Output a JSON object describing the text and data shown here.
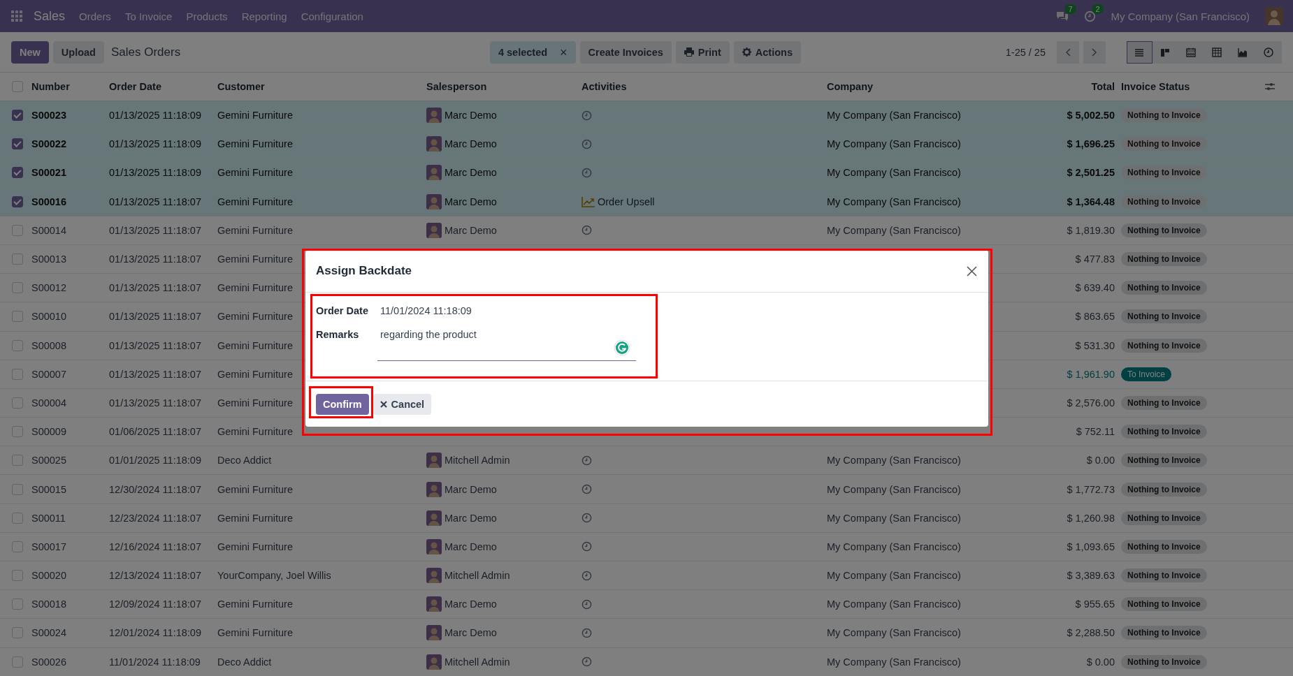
{
  "navbar": {
    "app": "Sales",
    "menus": [
      "Orders",
      "To Invoice",
      "Products",
      "Reporting",
      "Configuration"
    ],
    "messages_badge": "7",
    "activities_badge": "2",
    "company": "My Company (San Francisco)"
  },
  "control_panel": {
    "buttons": [
      {
        "label": "New",
        "kind": "primary"
      },
      {
        "label": "Upload",
        "kind": "secondary"
      }
    ],
    "title": "Sales Orders",
    "selection": {
      "label": "4 selected",
      "clear": "×"
    },
    "actions": [
      {
        "label": "Create Invoices"
      },
      {
        "label": "Print"
      },
      {
        "label": "Actions"
      }
    ],
    "pager": "1-25 / 25",
    "views": [
      {
        "kind": "list",
        "selected": true
      },
      {
        "kind": "kanban",
        "selected": false
      },
      {
        "kind": "calendar",
        "selected": false
      },
      {
        "kind": "pivot",
        "selected": false
      },
      {
        "kind": "graph",
        "selected": false
      },
      {
        "kind": "activity",
        "selected": false
      }
    ]
  },
  "table": {
    "select_all": {
      "checked": false
    },
    "columns": [
      "Number",
      "Order Date",
      "Customer",
      "Salesperson",
      "Activities",
      "Company",
      "Total",
      "Invoice Status"
    ],
    "rows": [
      {
        "number": "S00023",
        "order_date": "01/13/2025 11:18:09",
        "customer": "Gemini Furniture",
        "salesperson": "Marc Demo",
        "activity": {
          "kind": "clock"
        },
        "company": "My Company (San Francisco)",
        "total": "$ 5,002.50",
        "status": {
          "label": "Nothing to Invoice",
          "kind": "nothing"
        },
        "selected": true
      },
      {
        "number": "S00022",
        "order_date": "01/13/2025 11:18:09",
        "customer": "Gemini Furniture",
        "salesperson": "Marc Demo",
        "activity": {
          "kind": "clock"
        },
        "company": "My Company (San Francisco)",
        "total": "$ 1,696.25",
        "status": {
          "label": "Nothing to Invoice",
          "kind": "nothing"
        },
        "selected": true
      },
      {
        "number": "S00021",
        "order_date": "01/13/2025 11:18:09",
        "customer": "Gemini Furniture",
        "salesperson": "Marc Demo",
        "activity": {
          "kind": "clock"
        },
        "company": "My Company (San Francisco)",
        "total": "$ 2,501.25",
        "status": {
          "label": "Nothing to Invoice",
          "kind": "nothing"
        },
        "selected": true
      },
      {
        "number": "S00016",
        "order_date": "01/13/2025 11:18:07",
        "customer": "Gemini Furniture",
        "salesperson": "Marc Demo",
        "activity": {
          "kind": "upsell",
          "label": "Order Upsell"
        },
        "company": "My Company (San Francisco)",
        "total": "$ 1,364.48",
        "status": {
          "label": "Nothing to Invoice",
          "kind": "nothing"
        },
        "selected": true
      },
      {
        "number": "S00014",
        "order_date": "01/13/2025 11:18:07",
        "customer": "Gemini Furniture",
        "salesperson": "Marc Demo",
        "activity": {
          "kind": "clock"
        },
        "company": "My Company (San Francisco)",
        "total": "$ 1,819.30",
        "status": {
          "label": "Nothing to Invoice",
          "kind": "nothing"
        },
        "selected": false
      },
      {
        "number": "S00013",
        "order_date": "01/13/2025 11:18:07",
        "customer": "Gemini Furniture",
        "total": "$ 477.83",
        "status": {
          "label": "Nothing to Invoice",
          "kind": "nothing"
        },
        "selected": false
      },
      {
        "number": "S00012",
        "order_date": "01/13/2025 11:18:07",
        "customer": "Gemini Furniture",
        "total": "$ 639.40",
        "status": {
          "label": "Nothing to Invoice",
          "kind": "nothing"
        },
        "selected": false
      },
      {
        "number": "S00010",
        "order_date": "01/13/2025 11:18:07",
        "customer": "Gemini Furniture",
        "total": "$ 863.65",
        "status": {
          "label": "Nothing to Invoice",
          "kind": "nothing"
        },
        "selected": false
      },
      {
        "number": "S00008",
        "order_date": "01/13/2025 11:18:07",
        "customer": "Gemini Furniture",
        "total": "$ 531.30",
        "status": {
          "label": "Nothing to Invoice",
          "kind": "nothing"
        },
        "selected": false
      },
      {
        "number": "S00007",
        "order_date": "01/13/2025 11:18:07",
        "customer": "Gemini Furniture",
        "total": "$ 1,961.90",
        "status": {
          "label": "To Invoice",
          "kind": "to_invoice"
        },
        "selected": false
      },
      {
        "number": "S00004",
        "order_date": "01/13/2025 11:18:07",
        "customer": "Gemini Furniture",
        "total": "$ 2,576.00",
        "status": {
          "label": "Nothing to Invoice",
          "kind": "nothing"
        },
        "selected": false
      },
      {
        "number": "S00009",
        "order_date": "01/06/2025 11:18:07",
        "customer": "Gemini Furniture",
        "total": "$ 752.11",
        "status": {
          "label": "Nothing to Invoice",
          "kind": "nothing"
        },
        "selected": false
      },
      {
        "number": "S00025",
        "order_date": "01/01/2025 11:18:09",
        "customer": "Deco Addict",
        "salesperson": "Mitchell Admin",
        "activity": {
          "kind": "clock"
        },
        "company": "My Company (San Francisco)",
        "total": "$ 0.00",
        "status": {
          "label": "Nothing to Invoice",
          "kind": "nothing"
        },
        "selected": false
      },
      {
        "number": "S00015",
        "order_date": "12/30/2024 11:18:07",
        "customer": "Gemini Furniture",
        "salesperson": "Marc Demo",
        "activity": {
          "kind": "clock"
        },
        "company": "My Company (San Francisco)",
        "total": "$ 1,772.73",
        "status": {
          "label": "Nothing to Invoice",
          "kind": "nothing"
        },
        "selected": false
      },
      {
        "number": "S00011",
        "order_date": "12/23/2024 11:18:07",
        "customer": "Gemini Furniture",
        "salesperson": "Marc Demo",
        "activity": {
          "kind": "clock"
        },
        "company": "My Company (San Francisco)",
        "total": "$ 1,260.98",
        "status": {
          "label": "Nothing to Invoice",
          "kind": "nothing"
        },
        "selected": false
      },
      {
        "number": "S00017",
        "order_date": "12/16/2024 11:18:07",
        "customer": "Gemini Furniture",
        "salesperson": "Marc Demo",
        "activity": {
          "kind": "clock"
        },
        "company": "My Company (San Francisco)",
        "total": "$ 1,093.65",
        "status": {
          "label": "Nothing to Invoice",
          "kind": "nothing"
        },
        "selected": false
      },
      {
        "number": "S00020",
        "order_date": "12/13/2024 11:18:07",
        "customer": "YourCompany, Joel Willis",
        "salesperson": "Mitchell Admin",
        "activity": {
          "kind": "clock"
        },
        "company": "My Company (San Francisco)",
        "total": "$ 3,389.63",
        "status": {
          "label": "Nothing to Invoice",
          "kind": "nothing"
        },
        "selected": false
      },
      {
        "number": "S00018",
        "order_date": "12/09/2024 11:18:07",
        "customer": "Gemini Furniture",
        "salesperson": "Marc Demo",
        "activity": {
          "kind": "clock"
        },
        "company": "My Company (San Francisco)",
        "total": "$ 955.65",
        "status": {
          "label": "Nothing to Invoice",
          "kind": "nothing"
        },
        "selected": false
      },
      {
        "number": "S00024",
        "order_date": "12/01/2024 11:18:09",
        "customer": "Gemini Furniture",
        "salesperson": "Marc Demo",
        "activity": {
          "kind": "clock"
        },
        "company": "My Company (San Francisco)",
        "total": "$ 2,288.50",
        "status": {
          "label": "Nothing to Invoice",
          "kind": "nothing"
        },
        "selected": false
      },
      {
        "number": "S00026",
        "order_date": "11/01/2024 11:18:09",
        "customer": "Deco Addict",
        "salesperson": "Mitchell Admin",
        "activity": {
          "kind": "clock"
        },
        "company": "My Company (San Francisco)",
        "total": "$ 0.00",
        "status": {
          "label": "Nothing to Invoice",
          "kind": "nothing"
        },
        "selected": false
      }
    ]
  },
  "dialog": {
    "title": "Assign Backdate",
    "fields": [
      {
        "label": "Order Date",
        "value": "11/01/2024 11:18:09",
        "kind": "date"
      },
      {
        "label": "Remarks",
        "value": "regarding the product",
        "kind": "text"
      }
    ],
    "buttons": [
      {
        "label": "Confirm",
        "kind": "primary"
      },
      {
        "label": "Cancel",
        "kind": "cancel"
      }
    ]
  }
}
